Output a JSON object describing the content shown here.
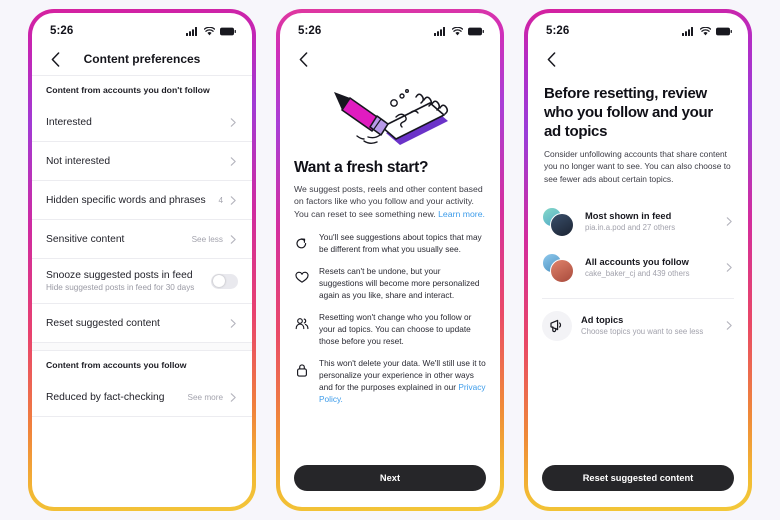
{
  "meta": {
    "background_color": "#f7f6fb",
    "frame_gradient": [
      "#d6219e",
      "#a13ad4",
      "#e8416f",
      "#f0803c",
      "#f3c53a"
    ],
    "link_color": "#3d9cea",
    "cta_color": "#262629"
  },
  "status_bar": {
    "time": "5:26",
    "icons": [
      "cellular-signal-icon",
      "wifi-icon",
      "battery-icon"
    ]
  },
  "phone1": {
    "nav": {
      "back_icon": "chevron-left-icon",
      "title": "Content preferences"
    },
    "section1_header": "Content from accounts you don't follow",
    "rows": [
      {
        "title": "Interested",
        "sub": "",
        "meta": "",
        "control": "chevron"
      },
      {
        "title": "Not interested",
        "sub": "",
        "meta": "",
        "control": "chevron"
      },
      {
        "title": "Hidden specific words and phrases",
        "sub": "",
        "meta": "4",
        "control": "chevron"
      },
      {
        "title": "Sensitive content",
        "sub": "",
        "meta": "See less",
        "control": "chevron"
      },
      {
        "title": "Snooze suggested posts in feed",
        "sub": "Hide suggested posts in feed for 30 days",
        "meta": "",
        "control": "toggle",
        "toggle_on": false
      },
      {
        "title": "Reset suggested content",
        "sub": "",
        "meta": "",
        "control": "chevron"
      }
    ],
    "section2_header": "Content from accounts you follow",
    "rows2": [
      {
        "title": "Reduced by fact-checking",
        "sub": "",
        "meta": "See more",
        "control": "chevron"
      }
    ]
  },
  "phone2": {
    "nav": {
      "back_icon": "chevron-left-icon"
    },
    "illustration": "pencil-erasing-notepad-illustration",
    "title": "Want a fresh start?",
    "lead_text": "We suggest posts, reels and other content based on factors like who you follow and your activity. You can reset to see something new. ",
    "lead_link": "Learn more.",
    "bullets": [
      {
        "icon": "refresh-icon",
        "text": "You'll see suggestions about topics that may be different from what you usually see."
      },
      {
        "icon": "heart-icon",
        "text": "Resets can't be undone, but your suggestions will become more personalized again as you like, share and interact."
      },
      {
        "icon": "people-icon",
        "text": "Resetting won't change who you follow or your ad topics. You can choose to update those before you reset."
      },
      {
        "icon": "lock-icon",
        "text": "This won't delete your data. We'll still use it to personalize your experience in other ways and for the purposes explained in our ",
        "link": "Privacy Policy."
      }
    ],
    "cta_label": "Next"
  },
  "phone3": {
    "nav": {
      "back_icon": "chevron-left-icon"
    },
    "title": "Before resetting, review who you follow and your ad topics",
    "lead_text": "Consider unfollowing accounts that share content you no longer want to see. You can also choose to see fewer ads about certain topics.",
    "accounts": [
      {
        "title": "Most shown in feed",
        "sub": "pia.in.a.pod and 27 others",
        "avatar_back": "#7fd4c6",
        "avatar_front": "#2b3a52",
        "icon": "avatar-stack"
      },
      {
        "title": "All accounts you follow",
        "sub": "cake_baker_cj and 439 others",
        "avatar_back": "#7fc4e8",
        "avatar_front": "#d4674f",
        "icon": "avatar-stack"
      }
    ],
    "topic_row": {
      "icon": "megaphone-icon",
      "title": "Ad topics",
      "sub": "Choose topics you want to see less"
    },
    "cta_label": "Reset suggested content"
  }
}
